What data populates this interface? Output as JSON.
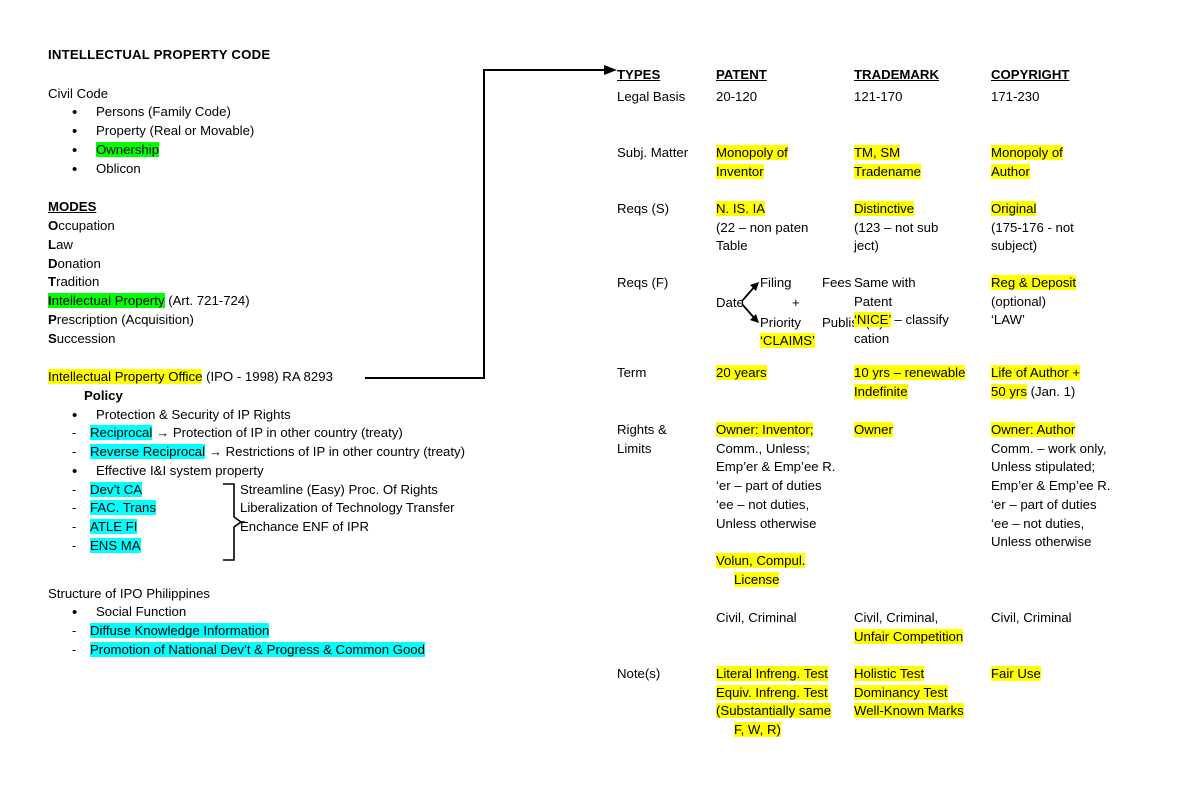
{
  "document": {
    "title": "INTELLECTUAL PROPERTY CODE"
  },
  "colors": {
    "highlight_yellow": "#FFFF00",
    "highlight_green": "#00FF00",
    "highlight_cyan": "#00FFFF",
    "text": "#000000",
    "background": "#FFFFFF"
  },
  "left": {
    "civil_code": {
      "heading": "Civil Code",
      "items": [
        {
          "text": "Persons (Family Code)",
          "highlight": "none"
        },
        {
          "text": "Property (Real or Movable)",
          "highlight": "none"
        },
        {
          "text": "Ownership",
          "highlight": "green"
        },
        {
          "text": "Oblicon",
          "highlight": "none"
        }
      ]
    },
    "modes": {
      "heading": "MODES",
      "items": [
        {
          "initial": "O",
          "rest": "ccupation",
          "suffix": "",
          "highlight": "none"
        },
        {
          "initial": "L",
          "rest": "aw",
          "suffix": "",
          "highlight": "none"
        },
        {
          "initial": "D",
          "rest": "onation",
          "suffix": "",
          "highlight": "none"
        },
        {
          "initial": "T",
          "rest": "radition",
          "suffix": "",
          "highlight": "none"
        },
        {
          "initial": "I",
          "rest": "ntellectual Property",
          "suffix": " (Art. 721-724)",
          "highlight": "green"
        },
        {
          "initial": "P",
          "rest": "rescription (Acquisition)",
          "suffix": "",
          "highlight": "none"
        },
        {
          "initial": "S",
          "rest": "uccession",
          "suffix": "",
          "highlight": "none"
        }
      ]
    },
    "ipo": {
      "highlighted": "Intellectual Property Office",
      "rest": " (IPO - 1998) RA 8293",
      "policy_heading": "Policy",
      "bullet_1": "Protection & Security of IP Rights",
      "dash_1_hl": "Reciprocal",
      "dash_1_rest": " → Protection of IP in other country (treaty)",
      "dash_2_hl": "Reverse Reciprocal",
      "dash_2_rest": " → Restrictions of IP in other country (treaty)",
      "bullet_2": "Effective I&I system property",
      "brace_items": [
        "Dev’t CA",
        "FAC. Trans",
        "ATLE FI",
        "ENS MA"
      ],
      "brace_rights": [
        "Streamline (Easy) Proc. Of Rights",
        "Liberalization of Technology Transfer",
        "Enchance ENF of IPR"
      ]
    },
    "structure": {
      "heading": "Structure of IPO Philippines",
      "bullet_1": "Social Function",
      "dash_1": "Diffuse Knowledge Information",
      "dash_2": "Promotion of National Dev’t & Progress & Common Good"
    }
  },
  "table": {
    "headers": [
      "TYPES",
      "PATENT",
      "TRADEMARK",
      "COPYRIGHT"
    ],
    "rows": [
      {
        "label": "Legal Basis",
        "patent": [
          {
            "t": "20-120",
            "h": "none"
          }
        ],
        "trademark": [
          {
            "t": "121-170",
            "h": "none"
          }
        ],
        "copyright": [
          {
            "t": "171-230",
            "h": "none"
          }
        ]
      },
      {
        "label": "Subj. Matter",
        "patent": [
          {
            "t": "Monopoly of",
            "h": "yellow"
          },
          {
            "t": "Inventor",
            "h": "yellow"
          }
        ],
        "trademark": [
          {
            "t": "TM, SM",
            "h": "yellow"
          },
          {
            "t": "Tradename",
            "h": "yellow"
          }
        ],
        "copyright": [
          {
            "t": "Monopoly of",
            "h": "yellow"
          },
          {
            "t": "Author",
            "h": "yellow"
          }
        ]
      },
      {
        "label": "Reqs (S)",
        "patent": [
          {
            "t": "N. IS. IA",
            "h": "yellow"
          },
          {
            "t": "(22 – non paten",
            "h": "none"
          },
          {
            "t": "Table",
            "h": "none"
          }
        ],
        "trademark": [
          {
            "t": "Distinctive",
            "h": "yellow"
          },
          {
            "t": "(123 – not sub",
            "h": "none"
          },
          {
            "t": "ject)",
            "h": "none"
          }
        ],
        "copyright": [
          {
            "t": "Original",
            "h": "yellow"
          },
          {
            "t": "(175-176 - not",
            "h": "none"
          },
          {
            "t": "subject)",
            "h": "none"
          }
        ]
      },
      {
        "label": "Reqs (F)",
        "patent_diagram": {
          "date": "Date",
          "filing": "Filing",
          "priority": "Priority",
          "fees": "Fees",
          "plus": "+",
          "publish": "Publish(R)",
          "claims": "‘CLAIMS’"
        },
        "trademark": [
          {
            "t": "Same with",
            "h": "none"
          },
          {
            "t": "Patent",
            "h": "none"
          },
          {
            "t": "‘NICE’",
            "h": "yellow",
            "tail": " – classify"
          },
          {
            "t": "cation",
            "h": "none"
          }
        ],
        "copyright": [
          {
            "t": "Reg & Deposit",
            "h": "yellow"
          },
          {
            "t": "(optional)",
            "h": "none"
          },
          {
            "t": "‘LAW’",
            "h": "none"
          }
        ]
      },
      {
        "label": "Term",
        "patent": [
          {
            "t": "20 years",
            "h": "yellow"
          }
        ],
        "trademark": [
          {
            "t": "10 yrs – renewable",
            "h": "yellow"
          },
          {
            "t": "Indefinite",
            "h": "yellow"
          }
        ],
        "copyright": [
          {
            "t": "Life of Author +",
            "h": "yellow"
          },
          {
            "t": "50 yrs",
            "h": "yellow",
            "tail": " (Jan. 1)"
          }
        ]
      },
      {
        "label": "Rights &",
        "label2": "Limits",
        "patent": [
          {
            "t": "Owner: Inventor;",
            "h": "yellow"
          },
          {
            "t": "Comm., Unless;",
            "h": "none"
          },
          {
            "t": "Emp’er & Emp’ee R.",
            "h": "none"
          },
          {
            "t": "‘er – part of duties",
            "h": "none"
          },
          {
            "t": "‘ee – not duties,",
            "h": "none"
          },
          {
            "t": "Unless otherwise",
            "h": "none"
          },
          {
            "t": "",
            "h": "none"
          },
          {
            "t": "Volun, Compul.",
            "h": "yellow"
          },
          {
            "t": "License",
            "h": "yellow",
            "indent": true
          }
        ],
        "trademark": [
          {
            "t": "Owner",
            "h": "yellow"
          }
        ],
        "copyright": [
          {
            "t": "Owner: Author",
            "h": "yellow"
          },
          {
            "t": "Comm. – work only,",
            "h": "none"
          },
          {
            "t": "Unless stipulated;",
            "h": "none"
          },
          {
            "t": "Emp’er & Emp’ee R.",
            "h": "none"
          },
          {
            "t": "‘er – part of duties",
            "h": "none"
          },
          {
            "t": "‘ee – not duties,",
            "h": "none"
          },
          {
            "t": "Unless otherwise",
            "h": "none"
          }
        ]
      },
      {
        "label": "",
        "patent": [
          {
            "t": "Civil, Criminal",
            "h": "none"
          }
        ],
        "trademark": [
          {
            "t": "Civil, Criminal,",
            "h": "none"
          },
          {
            "t": "Unfair Competition",
            "h": "yellow"
          }
        ],
        "copyright": [
          {
            "t": "Civil, Criminal",
            "h": "none"
          }
        ]
      },
      {
        "label": "Note(s)",
        "patent": [
          {
            "t": "Literal Infreng. Test",
            "h": "yellow"
          },
          {
            "t": "Equiv. Infreng. Test",
            "h": "yellow"
          },
          {
            "t": "(Substantially same",
            "h": "yellow"
          },
          {
            "t": "F, W, R)",
            "h": "yellow",
            "indent": true
          }
        ],
        "trademark": [
          {
            "t": "Holistic Test",
            "h": "yellow"
          },
          {
            "t": "Dominancy Test",
            "h": "yellow"
          },
          {
            "t": "Well-Known Marks",
            "h": "yellow"
          }
        ],
        "copyright": [
          {
            "t": "Fair Use",
            "h": "yellow"
          }
        ]
      }
    ]
  }
}
